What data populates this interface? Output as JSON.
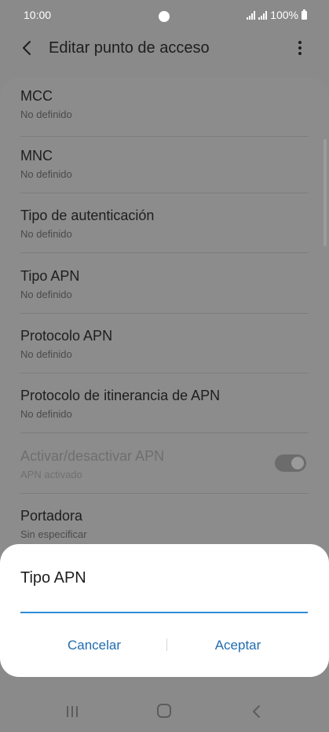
{
  "status": {
    "time": "10:00",
    "battery": "100%"
  },
  "header": {
    "title": "Editar punto de acceso"
  },
  "settings": [
    {
      "title": "MCC",
      "value": "No definido"
    },
    {
      "title": "MNC",
      "value": "No definido"
    },
    {
      "title": "Tipo de autenticación",
      "value": "No definido"
    },
    {
      "title": "Tipo APN",
      "value": "No definido"
    },
    {
      "title": "Protocolo APN",
      "value": "No definido"
    },
    {
      "title": "Protocolo de itinerancia de APN",
      "value": "No definido"
    },
    {
      "title": "Activar/desactivar APN",
      "value": "APN activado",
      "toggle_on": true,
      "enabled": false
    },
    {
      "title": "Portadora",
      "value": "Sin especificar"
    }
  ],
  "dialog": {
    "title": "Tipo APN",
    "input_value": "",
    "cancel_label": "Cancelar",
    "accept_label": "Aceptar"
  },
  "colors": {
    "accent": "#1f6cb0",
    "input_underline": "#2e8bd6",
    "scrim": "#8a8a8a"
  },
  "icons": [
    "back-arrow-icon",
    "more-vertical-icon",
    "recents-icon",
    "home-icon",
    "nav-back-icon"
  ]
}
